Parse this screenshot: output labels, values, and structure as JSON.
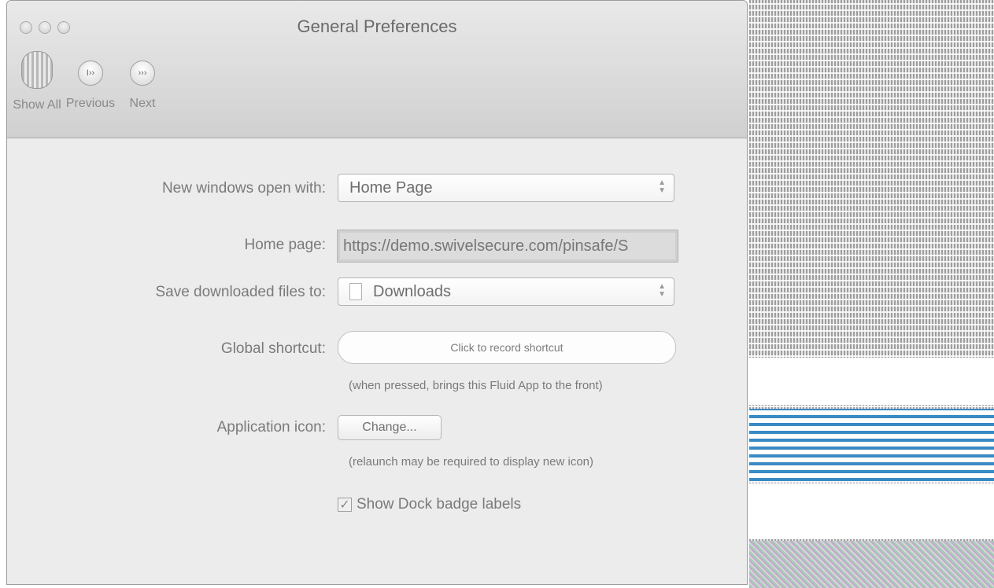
{
  "window": {
    "title": "General Preferences"
  },
  "toolbar": {
    "show_all": "Show All",
    "previous": "Previous",
    "next": "Next"
  },
  "form": {
    "new_windows_label": "New windows open with:",
    "new_windows_value": "Home Page",
    "home_page_label": "Home page:",
    "home_page_value": "https://demo.swivelsecure.com/pinsafe/S",
    "save_downloads_label": "Save downloaded files to:",
    "save_downloads_value": "Downloads",
    "global_shortcut_label": "Global shortcut:",
    "global_shortcut_button": "Click to record shortcut",
    "global_shortcut_hint": "(when pressed, brings this Fluid App to the front)",
    "app_icon_label": "Application icon:",
    "app_icon_button": "Change...",
    "app_icon_hint": "(relaunch may be required to display new icon)",
    "dock_badge_label": "Show Dock badge labels",
    "dock_badge_checked": true
  }
}
